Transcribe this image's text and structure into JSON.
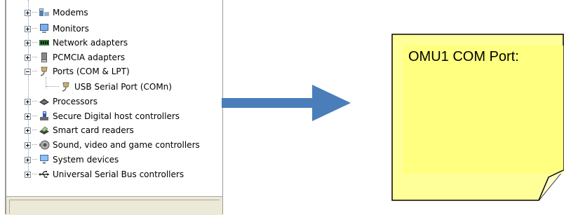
{
  "device_manager": {
    "items": [
      {
        "label": "Modems",
        "icon": "modem-icon",
        "expander": "plus",
        "level": 0
      },
      {
        "label": "Monitors",
        "icon": "monitor-icon",
        "expander": "plus",
        "level": 0
      },
      {
        "label": "Network adapters",
        "icon": "network-adapter-icon",
        "expander": "plus",
        "level": 0
      },
      {
        "label": "PCMCIA adapters",
        "icon": "pcmcia-icon",
        "expander": "plus",
        "level": 0
      },
      {
        "label": "Ports (COM & LPT)",
        "icon": "port-icon",
        "expander": "minus",
        "level": 0
      },
      {
        "label": "USB Serial Port (COMn)",
        "icon": "port-icon",
        "expander": "none",
        "level": 1
      },
      {
        "label": "Processors",
        "icon": "processor-icon",
        "expander": "plus",
        "level": 0
      },
      {
        "label": "Secure Digital host controllers",
        "icon": "sd-controller-icon",
        "expander": "plus",
        "level": 0
      },
      {
        "label": "Smart card readers",
        "icon": "smart-card-icon",
        "expander": "plus",
        "level": 0
      },
      {
        "label": "Sound, video and game controllers",
        "icon": "sound-icon",
        "expander": "plus",
        "level": 0
      },
      {
        "label": "System devices",
        "icon": "system-device-icon",
        "expander": "plus",
        "level": 0
      },
      {
        "label": "Universal Serial Bus controllers",
        "icon": "usb-icon",
        "expander": "plus",
        "level": 0
      }
    ]
  },
  "note": {
    "title": "OMU1 COM Port:",
    "background_color": "#ffff99",
    "inner_color": "#ffff80",
    "border_color": "#000000"
  },
  "arrow": {
    "color": "#4a7ebb"
  }
}
